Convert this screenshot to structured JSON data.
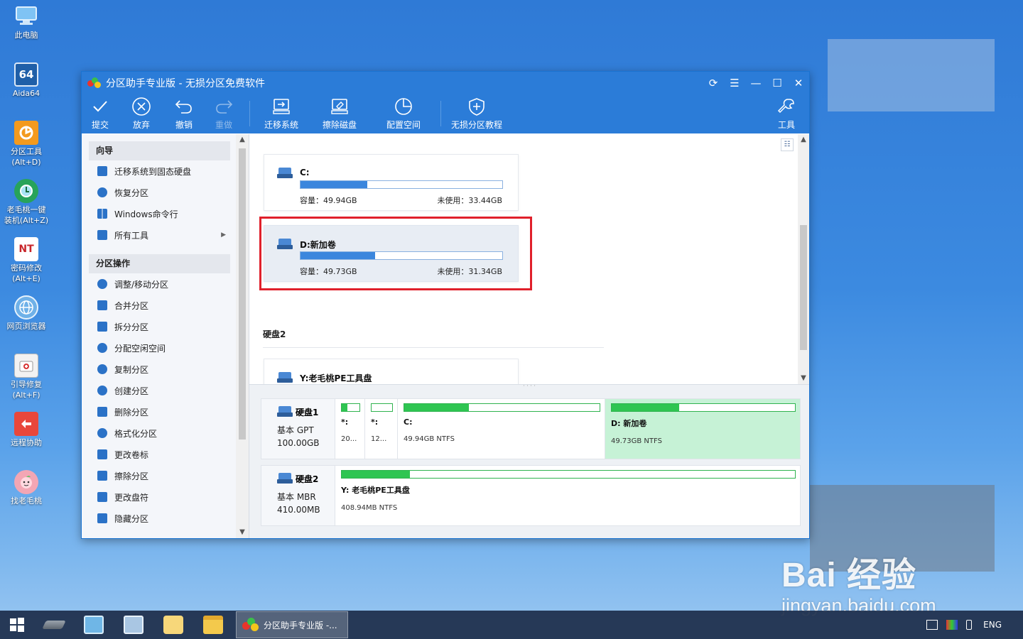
{
  "desktop": {
    "icons": [
      {
        "label": "此电脑",
        "icon": "computer-icon",
        "color": "#4aa3e8"
      },
      {
        "label": "Aida64",
        "icon": "aida64-icon",
        "color": "#1f5fa8",
        "glyph": "64"
      },
      {
        "label": "分区工具\n(Alt+D)",
        "icon": "partition-tool-icon",
        "color": "#f39a1e"
      },
      {
        "label": "老毛桃一键\n装机(Alt+Z)",
        "icon": "installer-icon",
        "color": "#27a35a"
      },
      {
        "label": "密码修改\n(Alt+E)",
        "icon": "password-key-icon",
        "color": "#c8262b",
        "glyph": "NT"
      },
      {
        "label": "网页浏览器",
        "icon": "browser-globe-icon",
        "color": "#6fb1e8"
      },
      {
        "label": "引导修复\n(Alt+F)",
        "icon": "boot-repair-icon",
        "color": "#d83a3a"
      },
      {
        "label": "远程协助",
        "icon": "remote-assist-icon",
        "color": "#e8473b"
      },
      {
        "label": "找老毛桃",
        "icon": "peach-mascot-icon",
        "color": "#f3a6b4"
      }
    ],
    "watermark": {
      "brand": "Bai 经验",
      "url": "jingyan.baidu.com"
    }
  },
  "window": {
    "title": "分区助手专业版 - 无损分区免费软件",
    "controls": [
      "refresh-icon",
      "menu-icon",
      "minimize-icon",
      "maximize-icon",
      "close-icon"
    ]
  },
  "toolbar": {
    "items": [
      {
        "label": "提交",
        "icon": "check-icon",
        "enabled": true
      },
      {
        "label": "放弃",
        "icon": "discard-icon",
        "enabled": true
      },
      {
        "label": "撤销",
        "icon": "undo-icon",
        "enabled": true
      },
      {
        "label": "重做",
        "icon": "redo-icon",
        "enabled": false
      },
      {
        "label": "迁移系统",
        "icon": "migrate-os-icon",
        "enabled": true
      },
      {
        "label": "擦除磁盘",
        "icon": "wipe-disk-icon",
        "enabled": true
      },
      {
        "label": "配置空间",
        "icon": "allocate-space-icon",
        "enabled": true
      },
      {
        "label": "无损分区教程",
        "icon": "tutorial-shield-icon",
        "enabled": true
      },
      {
        "label": "工具",
        "icon": "tools-wrench-icon",
        "enabled": true
      }
    ]
  },
  "sidebar": {
    "sections": [
      {
        "title": "向导",
        "items": [
          {
            "label": "迁移系统到固态硬盘",
            "icon": "migrate-ssd-icon"
          },
          {
            "label": "恢复分区",
            "icon": "recover-partition-icon"
          },
          {
            "label": "Windows命令行",
            "icon": "windows-icon"
          },
          {
            "label": "所有工具",
            "icon": "all-tools-icon",
            "submenu": true
          }
        ]
      },
      {
        "title": "分区操作",
        "items": [
          {
            "label": "调整/移动分区",
            "icon": "resize-partition-icon"
          },
          {
            "label": "合并分区",
            "icon": "merge-partition-icon"
          },
          {
            "label": "拆分分区",
            "icon": "split-partition-icon"
          },
          {
            "label": "分配空闲空间",
            "icon": "allocate-free-icon"
          },
          {
            "label": "复制分区",
            "icon": "copy-partition-icon"
          },
          {
            "label": "创建分区",
            "icon": "create-partition-icon"
          },
          {
            "label": "删除分区",
            "icon": "delete-partition-icon"
          },
          {
            "label": "格式化分区",
            "icon": "format-partition-icon"
          },
          {
            "label": "更改卷标",
            "icon": "change-label-icon"
          },
          {
            "label": "擦除分区",
            "icon": "wipe-partition-icon"
          },
          {
            "label": "更改盘符",
            "icon": "change-letter-icon"
          },
          {
            "label": "隐藏分区",
            "icon": "hide-partition-icon"
          }
        ]
      }
    ]
  },
  "partitions": {
    "cards": [
      {
        "name": "C:",
        "capacity": "容量：49.94GB",
        "free": "未使用：33.44GB",
        "used_fraction": 0.33
      },
      {
        "name": "D:新加卷",
        "capacity": "容量：49.73GB",
        "free": "未使用：31.34GB",
        "used_fraction": 0.37,
        "selected": true
      }
    ],
    "disk2_label": "硬盘2",
    "disk2_card": {
      "name": "Y:老毛桃PE工具盘"
    }
  },
  "disk_map": {
    "disks": [
      {
        "name": "硬盘1",
        "type": "基本 GPT",
        "size": "100.00GB",
        "segments": [
          {
            "name": "*:",
            "info": "20...",
            "used_fraction": 0.3
          },
          {
            "name": "*:",
            "info": "12...",
            "used_fraction": 0.0
          },
          {
            "name": "C:",
            "info": "49.94GB NTFS",
            "used_fraction": 0.33
          },
          {
            "name": "D: 新加卷",
            "info": "49.73GB NTFS",
            "used_fraction": 0.37,
            "selected": true
          }
        ]
      },
      {
        "name": "硬盘2",
        "type": "基本 MBR",
        "size": "410.00MB",
        "segments": [
          {
            "name": "Y: 老毛桃PE工具盘",
            "info": "408.94MB NTFS",
            "used_fraction": 0.15
          }
        ]
      }
    ]
  },
  "taskbar": {
    "pinned": [
      "start-windows-icon",
      "disk-drive-icon",
      "computer-manage-icon",
      "network-computer-icon",
      "search-magnifier-icon",
      "file-explorer-icon"
    ],
    "active_task": "分区助手专业版 -...",
    "tray_language": "ENG"
  },
  "colors": {
    "accent": "#2b7cd8",
    "partition_bar": "#3b86dd",
    "disk_bar": "#2fc552",
    "selected_segment": "#c6f2d6",
    "highlight": "#e0202b"
  }
}
